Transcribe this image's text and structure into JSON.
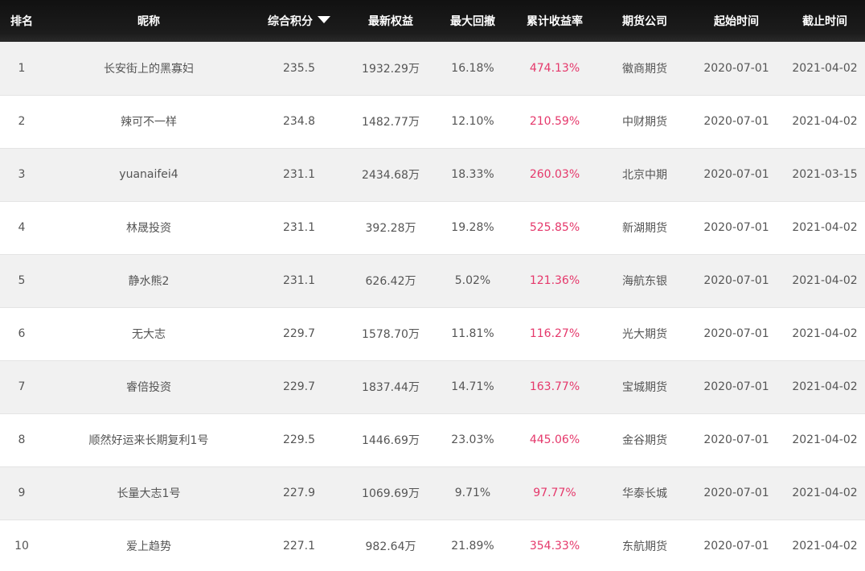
{
  "header": {
    "rank": "排名",
    "nickname": "昵称",
    "score": "综合积分",
    "equity": "最新权益",
    "drawdown": "最大回撤",
    "return": "累计收益率",
    "company": "期货公司",
    "start": "起始时间",
    "end": "截止时间",
    "sort_icon": "sort-desc-icon"
  },
  "colors": {
    "header_bg": "#111111",
    "row_odd": "#f1f1f1",
    "row_even": "#ffffff",
    "return_text": "#e5386b"
  },
  "rows": [
    {
      "rank": "1",
      "nickname": "长安街上的黑寡妇",
      "score": "235.5",
      "equity": "1932.29万",
      "drawdown": "16.18%",
      "return": "474.13%",
      "company": "徽商期货",
      "start": "2020-07-01",
      "end": "2021-04-02"
    },
    {
      "rank": "2",
      "nickname": "辣可不一样",
      "score": "234.8",
      "equity": "1482.77万",
      "drawdown": "12.10%",
      "return": "210.59%",
      "company": "中财期货",
      "start": "2020-07-01",
      "end": "2021-04-02"
    },
    {
      "rank": "3",
      "nickname": "yuanaifei4",
      "score": "231.1",
      "equity": "2434.68万",
      "drawdown": "18.33%",
      "return": "260.03%",
      "company": "北京中期",
      "start": "2020-07-01",
      "end": "2021-03-15"
    },
    {
      "rank": "4",
      "nickname": "林晟投资",
      "score": "231.1",
      "equity": "392.28万",
      "drawdown": "19.28%",
      "return": "525.85%",
      "company": "新湖期货",
      "start": "2020-07-01",
      "end": "2021-04-02"
    },
    {
      "rank": "5",
      "nickname": "静水熊2",
      "score": "231.1",
      "equity": "626.42万",
      "drawdown": "5.02%",
      "return": "121.36%",
      "company": "海航东银",
      "start": "2020-07-01",
      "end": "2021-04-02"
    },
    {
      "rank": "6",
      "nickname": "无大志",
      "score": "229.7",
      "equity": "1578.70万",
      "drawdown": "11.81%",
      "return": "116.27%",
      "company": "光大期货",
      "start": "2020-07-01",
      "end": "2021-04-02"
    },
    {
      "rank": "7",
      "nickname": "睿倍投资",
      "score": "229.7",
      "equity": "1837.44万",
      "drawdown": "14.71%",
      "return": "163.77%",
      "company": "宝城期货",
      "start": "2020-07-01",
      "end": "2021-04-02"
    },
    {
      "rank": "8",
      "nickname": "顺然好运来长期复利1号",
      "score": "229.5",
      "equity": "1446.69万",
      "drawdown": "23.03%",
      "return": "445.06%",
      "company": "金谷期货",
      "start": "2020-07-01",
      "end": "2021-04-02"
    },
    {
      "rank": "9",
      "nickname": "长量大志1号",
      "score": "227.9",
      "equity": "1069.69万",
      "drawdown": "9.71%",
      "return": "97.77%",
      "company": "华泰长城",
      "start": "2020-07-01",
      "end": "2021-04-02"
    },
    {
      "rank": "10",
      "nickname": "爱上趋势",
      "score": "227.1",
      "equity": "982.64万",
      "drawdown": "21.89%",
      "return": "354.33%",
      "company": "东航期货",
      "start": "2020-07-01",
      "end": "2021-04-02"
    }
  ]
}
